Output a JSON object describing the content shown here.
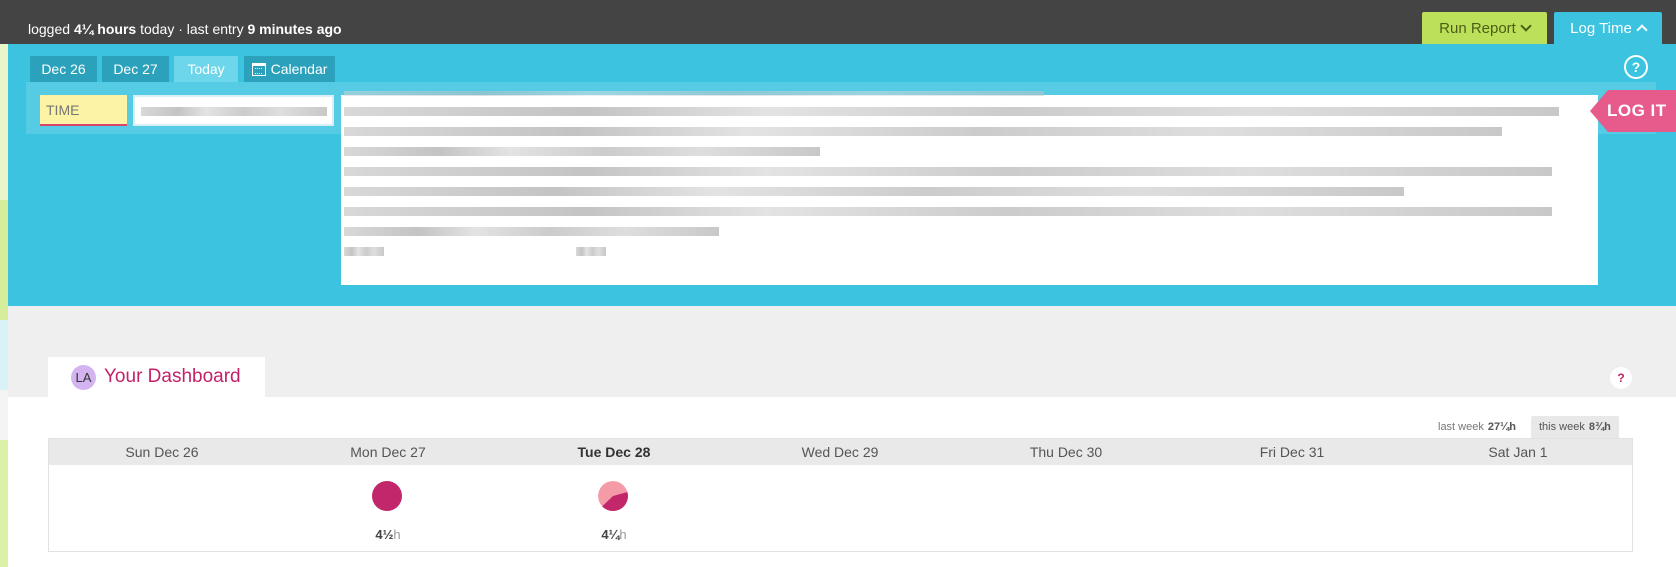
{
  "topbar": {
    "status_prefix": "logged ",
    "logged_hours": "4¼ hours",
    "status_middle": " today · last entry ",
    "last_entry": "9 minutes ago",
    "run_report_label": "Run Report",
    "log_time_label": "Log Time"
  },
  "tabs": [
    {
      "label": "Dec 26"
    },
    {
      "label": "Dec 27"
    },
    {
      "label": "Today"
    },
    {
      "label": "Calendar"
    }
  ],
  "entry": {
    "time_placeholder": "TIME",
    "help_label": "?",
    "log_it_label": "LOG IT"
  },
  "dashboard": {
    "avatar_initials": "LA",
    "title": "Your Dashboard",
    "help_label": "?",
    "last_week_label": "last week",
    "last_week_hours": "27¼h",
    "this_week_label": "this week",
    "this_week_hours": "8¾h",
    "days": [
      {
        "label": "Sun Dec 26",
        "hours": "",
        "unit": ""
      },
      {
        "label": "Mon Dec 27",
        "hours": "4½",
        "unit": "h"
      },
      {
        "label": "Tue Dec 28",
        "hours": "4¼",
        "unit": "h"
      },
      {
        "label": "Wed Dec 29",
        "hours": "",
        "unit": ""
      },
      {
        "label": "Thu Dec 30",
        "hours": "",
        "unit": ""
      },
      {
        "label": "Fri Dec 31",
        "hours": "",
        "unit": ""
      },
      {
        "label": "Sat Jan 1",
        "hours": "",
        "unit": ""
      }
    ]
  },
  "colors": {
    "top_bar": "#444444",
    "panel": "#3bc3df",
    "run_report": "#bde05a",
    "accent": "#c3216a",
    "log_it_arrow": "#e75a8c"
  }
}
